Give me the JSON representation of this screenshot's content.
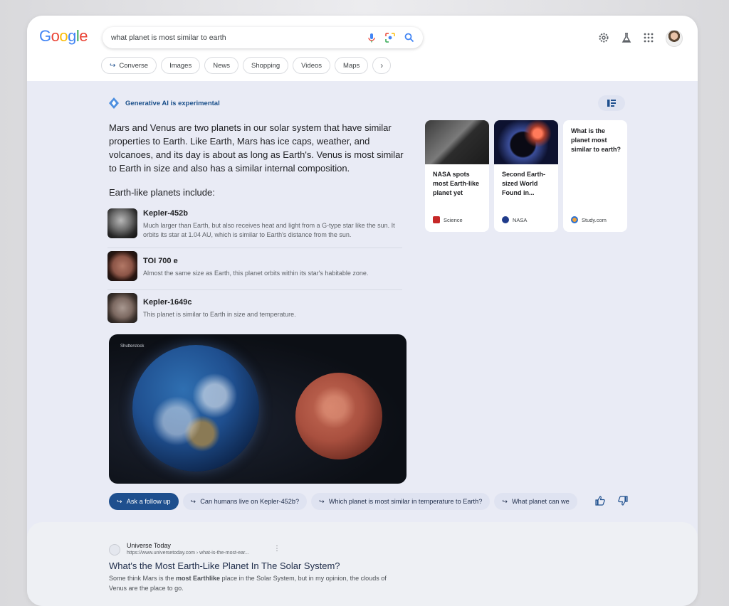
{
  "header": {
    "logo": "Google",
    "search_query": "what planet is most similar to earth"
  },
  "chips": [
    "Converse",
    "Images",
    "News",
    "Shopping",
    "Videos",
    "Maps"
  ],
  "ai": {
    "label": "Generative AI is experimental",
    "summary": "Mars and Venus are two planets in our solar system that have similar properties to Earth. Like Earth, Mars has ice caps, weather, and volcanoes, and its day is about as long as Earth's. Venus is most similar to Earth in size and also has a similar internal composition.",
    "subheading": "Earth-like planets include:",
    "planets": [
      {
        "name": "Kepler-452b",
        "desc": "Much larger than Earth, but also receives heat and light from a G-type star like the sun. It orbits its star at 1.04 AU, which is similar to Earth's distance from the sun."
      },
      {
        "name": "TOI 700 e",
        "desc": "Almost the same size as Earth, this planet orbits within its star's habitable zone."
      },
      {
        "name": "Kepler-1649c",
        "desc": "This planet is similar to Earth in size and temperature."
      }
    ],
    "image_credit": "Shutterstock"
  },
  "cards": [
    {
      "title": "NASA spots most Earth-like planet yet",
      "source": "Science"
    },
    {
      "title": "Second Earth-sized World Found in...",
      "source": "NASA"
    },
    {
      "title": "What is the planet most similar to earth?",
      "source": "Study.com"
    }
  ],
  "followups": {
    "primary": "Ask a follow up",
    "suggestions": [
      "Can humans live on Kepler-452b?",
      "Which planet is most similar in temperature to Earth?",
      "What planet can we"
    ]
  },
  "result": {
    "site_name": "Universe Today",
    "url": "https://www.universetoday.com › what-is-the-most-ear...",
    "title": "What's the Most Earth-Like Planet In The Solar System?",
    "snippet_pre": "Some think Mars is the ",
    "snippet_bold": "most Earthlike",
    "snippet_post": " place in the Solar System, but in my opinion, the clouds of Venus are the place to go."
  },
  "colors": {
    "accent": "#1e4f8e",
    "ai_label": "#1a4f8a",
    "panel_bg": "#e9ebf5"
  }
}
